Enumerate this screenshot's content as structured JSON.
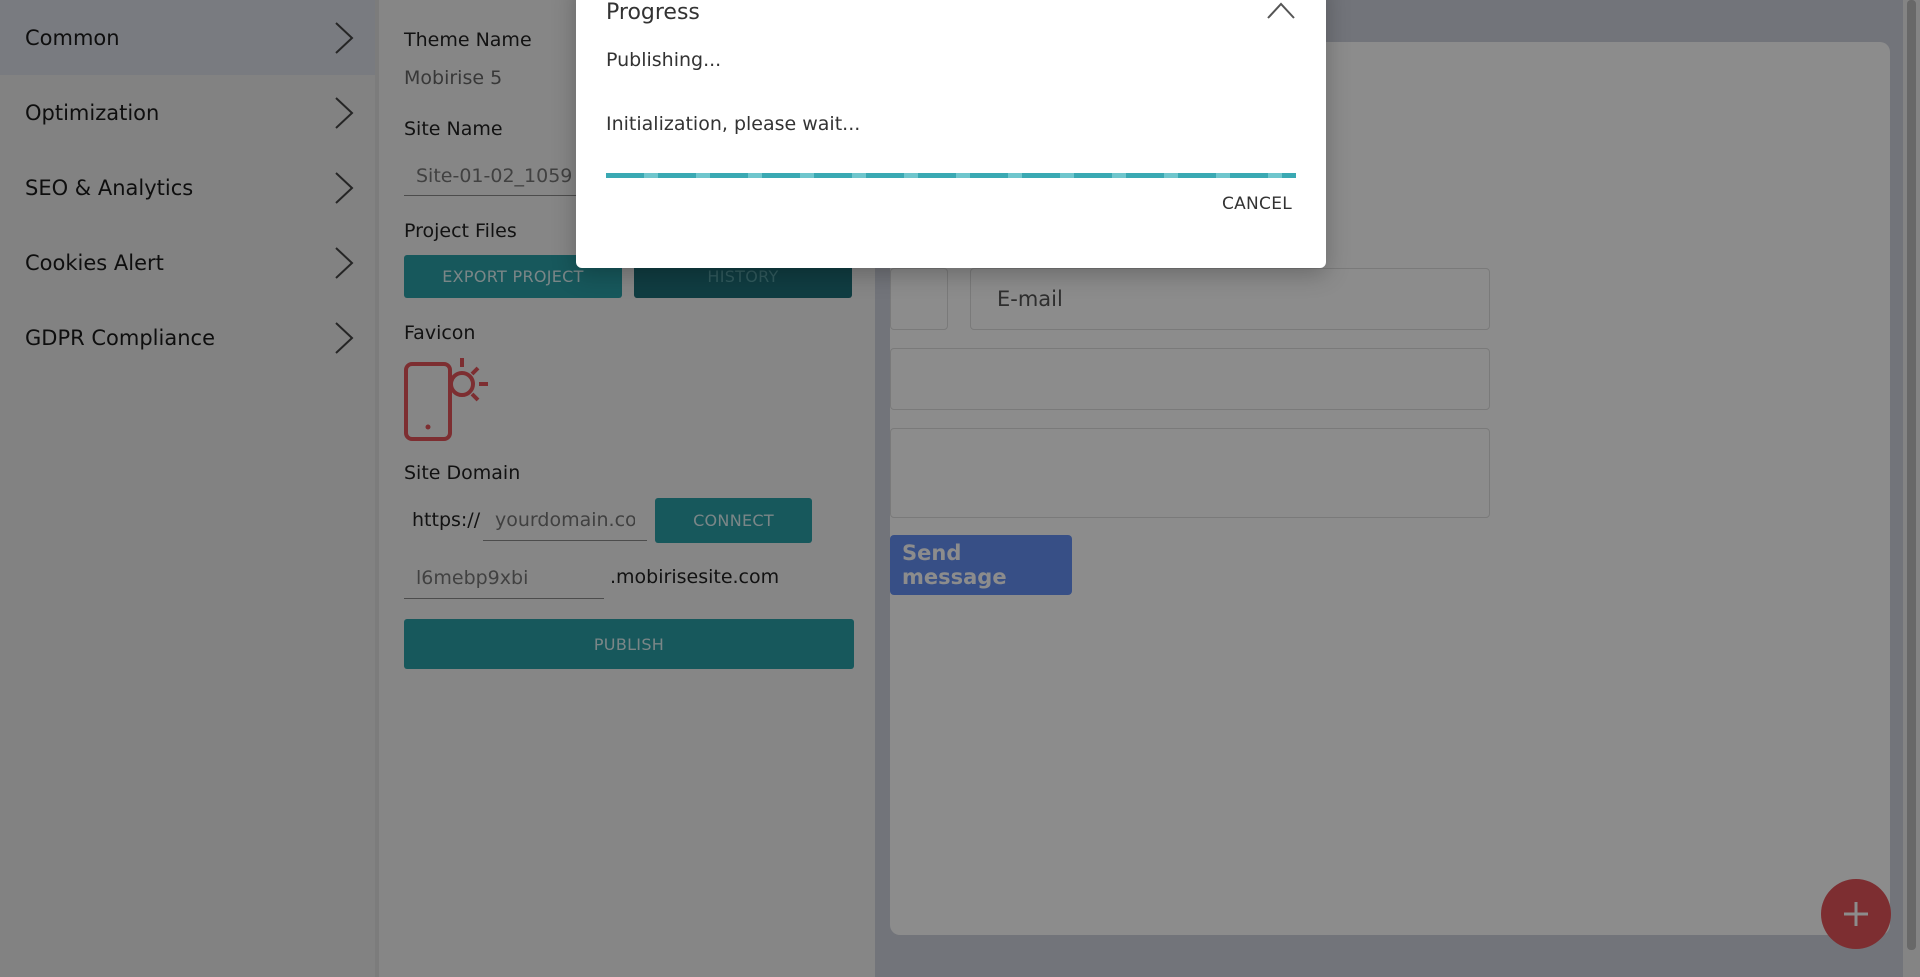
{
  "sidebar": {
    "items": [
      {
        "label": "Common",
        "active": true
      },
      {
        "label": "Optimization"
      },
      {
        "label": "SEO & Analytics"
      },
      {
        "label": "Cookies Alert"
      },
      {
        "label": "GDPR Compliance"
      }
    ]
  },
  "settings": {
    "theme_name_label": "Theme Name",
    "theme_name_value": "Mobirise 5",
    "site_name_label": "Site Name",
    "site_name_value": "Site-01-02_1059",
    "project_files_label": "Project Files",
    "export_button": "EXPORT PROJECT",
    "history_button": "HISTORY",
    "favicon_label": "Favicon",
    "site_domain_label": "Site Domain",
    "protocol": "https://",
    "domain_placeholder": "yourdomain.com",
    "connect_button": "CONNECT",
    "subdomain_value": "l6mebp9xbi",
    "subdomain_suffix": ".mobirisesite.com",
    "publish_button": "PUBLISH",
    "favicon_color": "#e35459",
    "teal_color": "#2aa0a8"
  },
  "preview": {
    "email_placeholder": "E-mail",
    "send_button": "Send message",
    "button_color": "#6590f5",
    "fab_icon": "plus-icon"
  },
  "dialog": {
    "title": "Progress",
    "status": "Publishing...",
    "message": "Initialization, please wait...",
    "cancel_label": "CANCEL",
    "progress_color": "#3aa9b3",
    "close_icon": "chevron-up-icon"
  }
}
